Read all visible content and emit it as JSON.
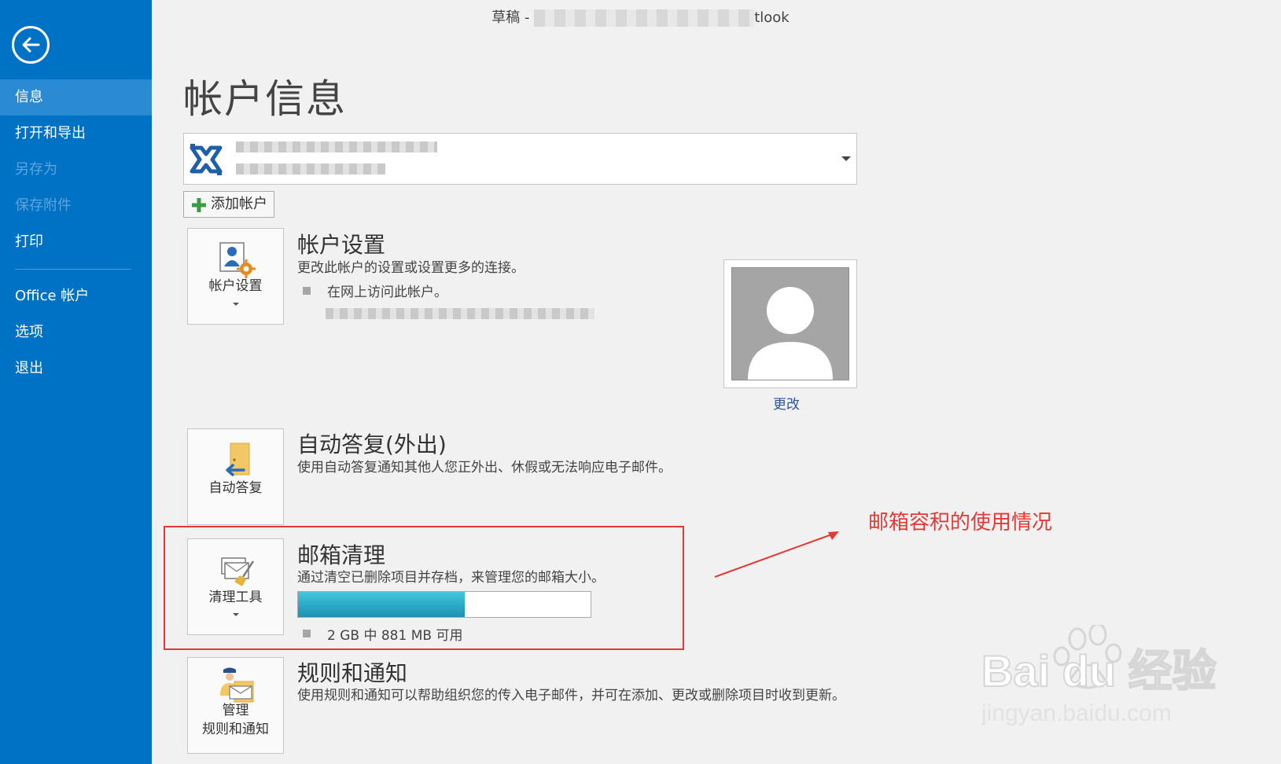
{
  "window": {
    "title_prefix": "草稿 -",
    "title_suffix": "tlook"
  },
  "sidebar": {
    "items": [
      {
        "label": "信息",
        "state": "active"
      },
      {
        "label": "打开和导出",
        "state": "normal"
      },
      {
        "label": "另存为",
        "state": "disabled"
      },
      {
        "label": "保存附件",
        "state": "disabled"
      },
      {
        "label": "打印",
        "state": "normal"
      },
      {
        "label": "Office 帐户",
        "state": "normal"
      },
      {
        "label": "选项",
        "state": "normal"
      },
      {
        "label": "退出",
        "state": "normal"
      }
    ]
  },
  "main": {
    "page_title": "帐户信息",
    "add_account_label": "添加帐户",
    "account_settings": {
      "tile_label": "帐户设置",
      "title": "帐户设置",
      "desc": "更改此帐户的设置或设置更多的连接。",
      "bullet": "在网上访问此帐户。"
    },
    "photo": {
      "change_label": "更改"
    },
    "auto_reply": {
      "tile_label": "自动答复",
      "title": "自动答复(外出)",
      "desc": "使用自动答复通知其他人您正外出、休假或无法响应电子邮件。"
    },
    "mailbox_cleanup": {
      "tile_label": "清理工具",
      "title": "邮箱清理",
      "desc": "通过清空已删除项目并存档，来管理您的邮箱大小。",
      "usage_text": "2 GB 中 881 MB 可用",
      "used_fraction": 0.57
    },
    "rules": {
      "tile_label_line1": "管理",
      "tile_label_line2": "规则和通知",
      "title": "规则和通知",
      "desc": "使用规则和通知可以帮助组织您的传入电子邮件，并可在添加、更改或删除项目时收到更新。"
    }
  },
  "annotation": {
    "text": "邮箱容积的使用情况"
  },
  "watermark": {
    "brand": "Bai du 经验",
    "url": "jingyan.baidu.com"
  },
  "colors": {
    "sidebar": "#0072c6",
    "annotation": "#e53935",
    "progress": "#2ba8c6"
  }
}
